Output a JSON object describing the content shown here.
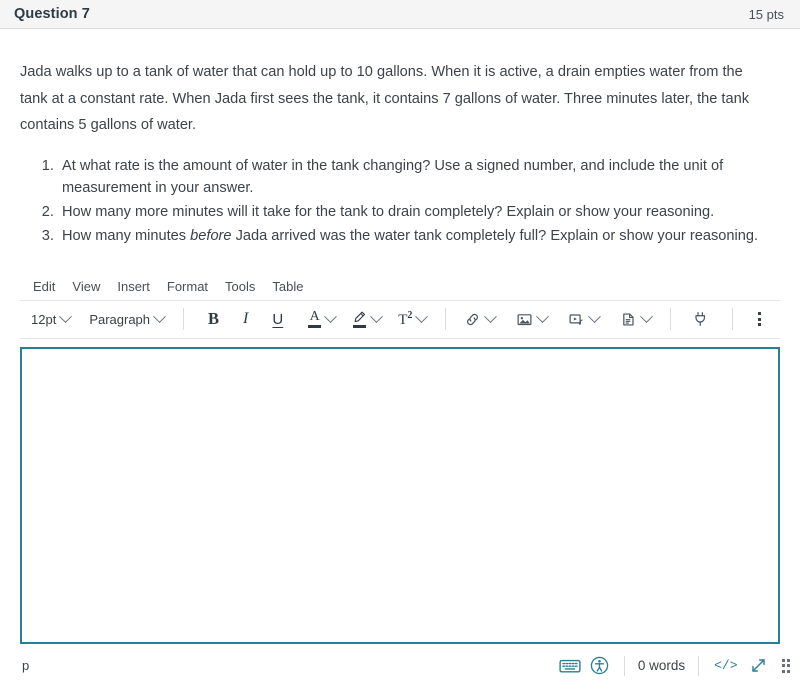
{
  "header": {
    "title": "Question 7",
    "points": "15 pts"
  },
  "question": {
    "prompt": "Jada walks up to a tank of water that can hold up to 10 gallons. When it is active, a drain empties water from the tank at a constant rate. When Jada first sees the tank, it contains 7 gallons of water. Three minutes later, the tank contains 5 gallons of water.",
    "items": [
      {
        "before": "At what rate is the amount of water in the tank changing? Use a signed number, and include the unit of measurement in your answer.",
        "em": "",
        "after": ""
      },
      {
        "before": "How many more minutes will it take for the tank to drain completely? Explain or show your reasoning.",
        "em": "",
        "after": ""
      },
      {
        "before": "How many minutes ",
        "em": "before",
        "after": " Jada arrived was the water tank completely full? Explain or show your reasoning."
      }
    ]
  },
  "editor": {
    "menu": [
      {
        "label": "Edit"
      },
      {
        "label": "View"
      },
      {
        "label": "Insert"
      },
      {
        "label": "Format"
      },
      {
        "label": "Tools"
      },
      {
        "label": "Table"
      }
    ],
    "toolbar": {
      "font_size": "12pt",
      "block_format": "Paragraph",
      "bold": "B",
      "italic": "I",
      "underline": "U",
      "superscript": "T",
      "superscript_exp": "2",
      "text_color_glyph": "A",
      "icons": {
        "link": "link-icon",
        "image": "image-icon",
        "media": "media-icon",
        "document": "document-icon",
        "apps": "apps-plug-icon",
        "more": "more-options-icon"
      }
    },
    "content": "",
    "status": {
      "element_path": "p",
      "word_count": "0 words",
      "html_editor": "</>",
      "keyboard_icon": "keyboard-shortcuts-icon",
      "accessibility_icon": "accessibility-checker-icon",
      "fullscreen_icon": "fullscreen-icon",
      "resize_icon": "resize-grip-icon"
    }
  },
  "colors": {
    "accent": "#2b7f95",
    "header_bg": "#f5f5f5",
    "text": "#3d4349"
  }
}
